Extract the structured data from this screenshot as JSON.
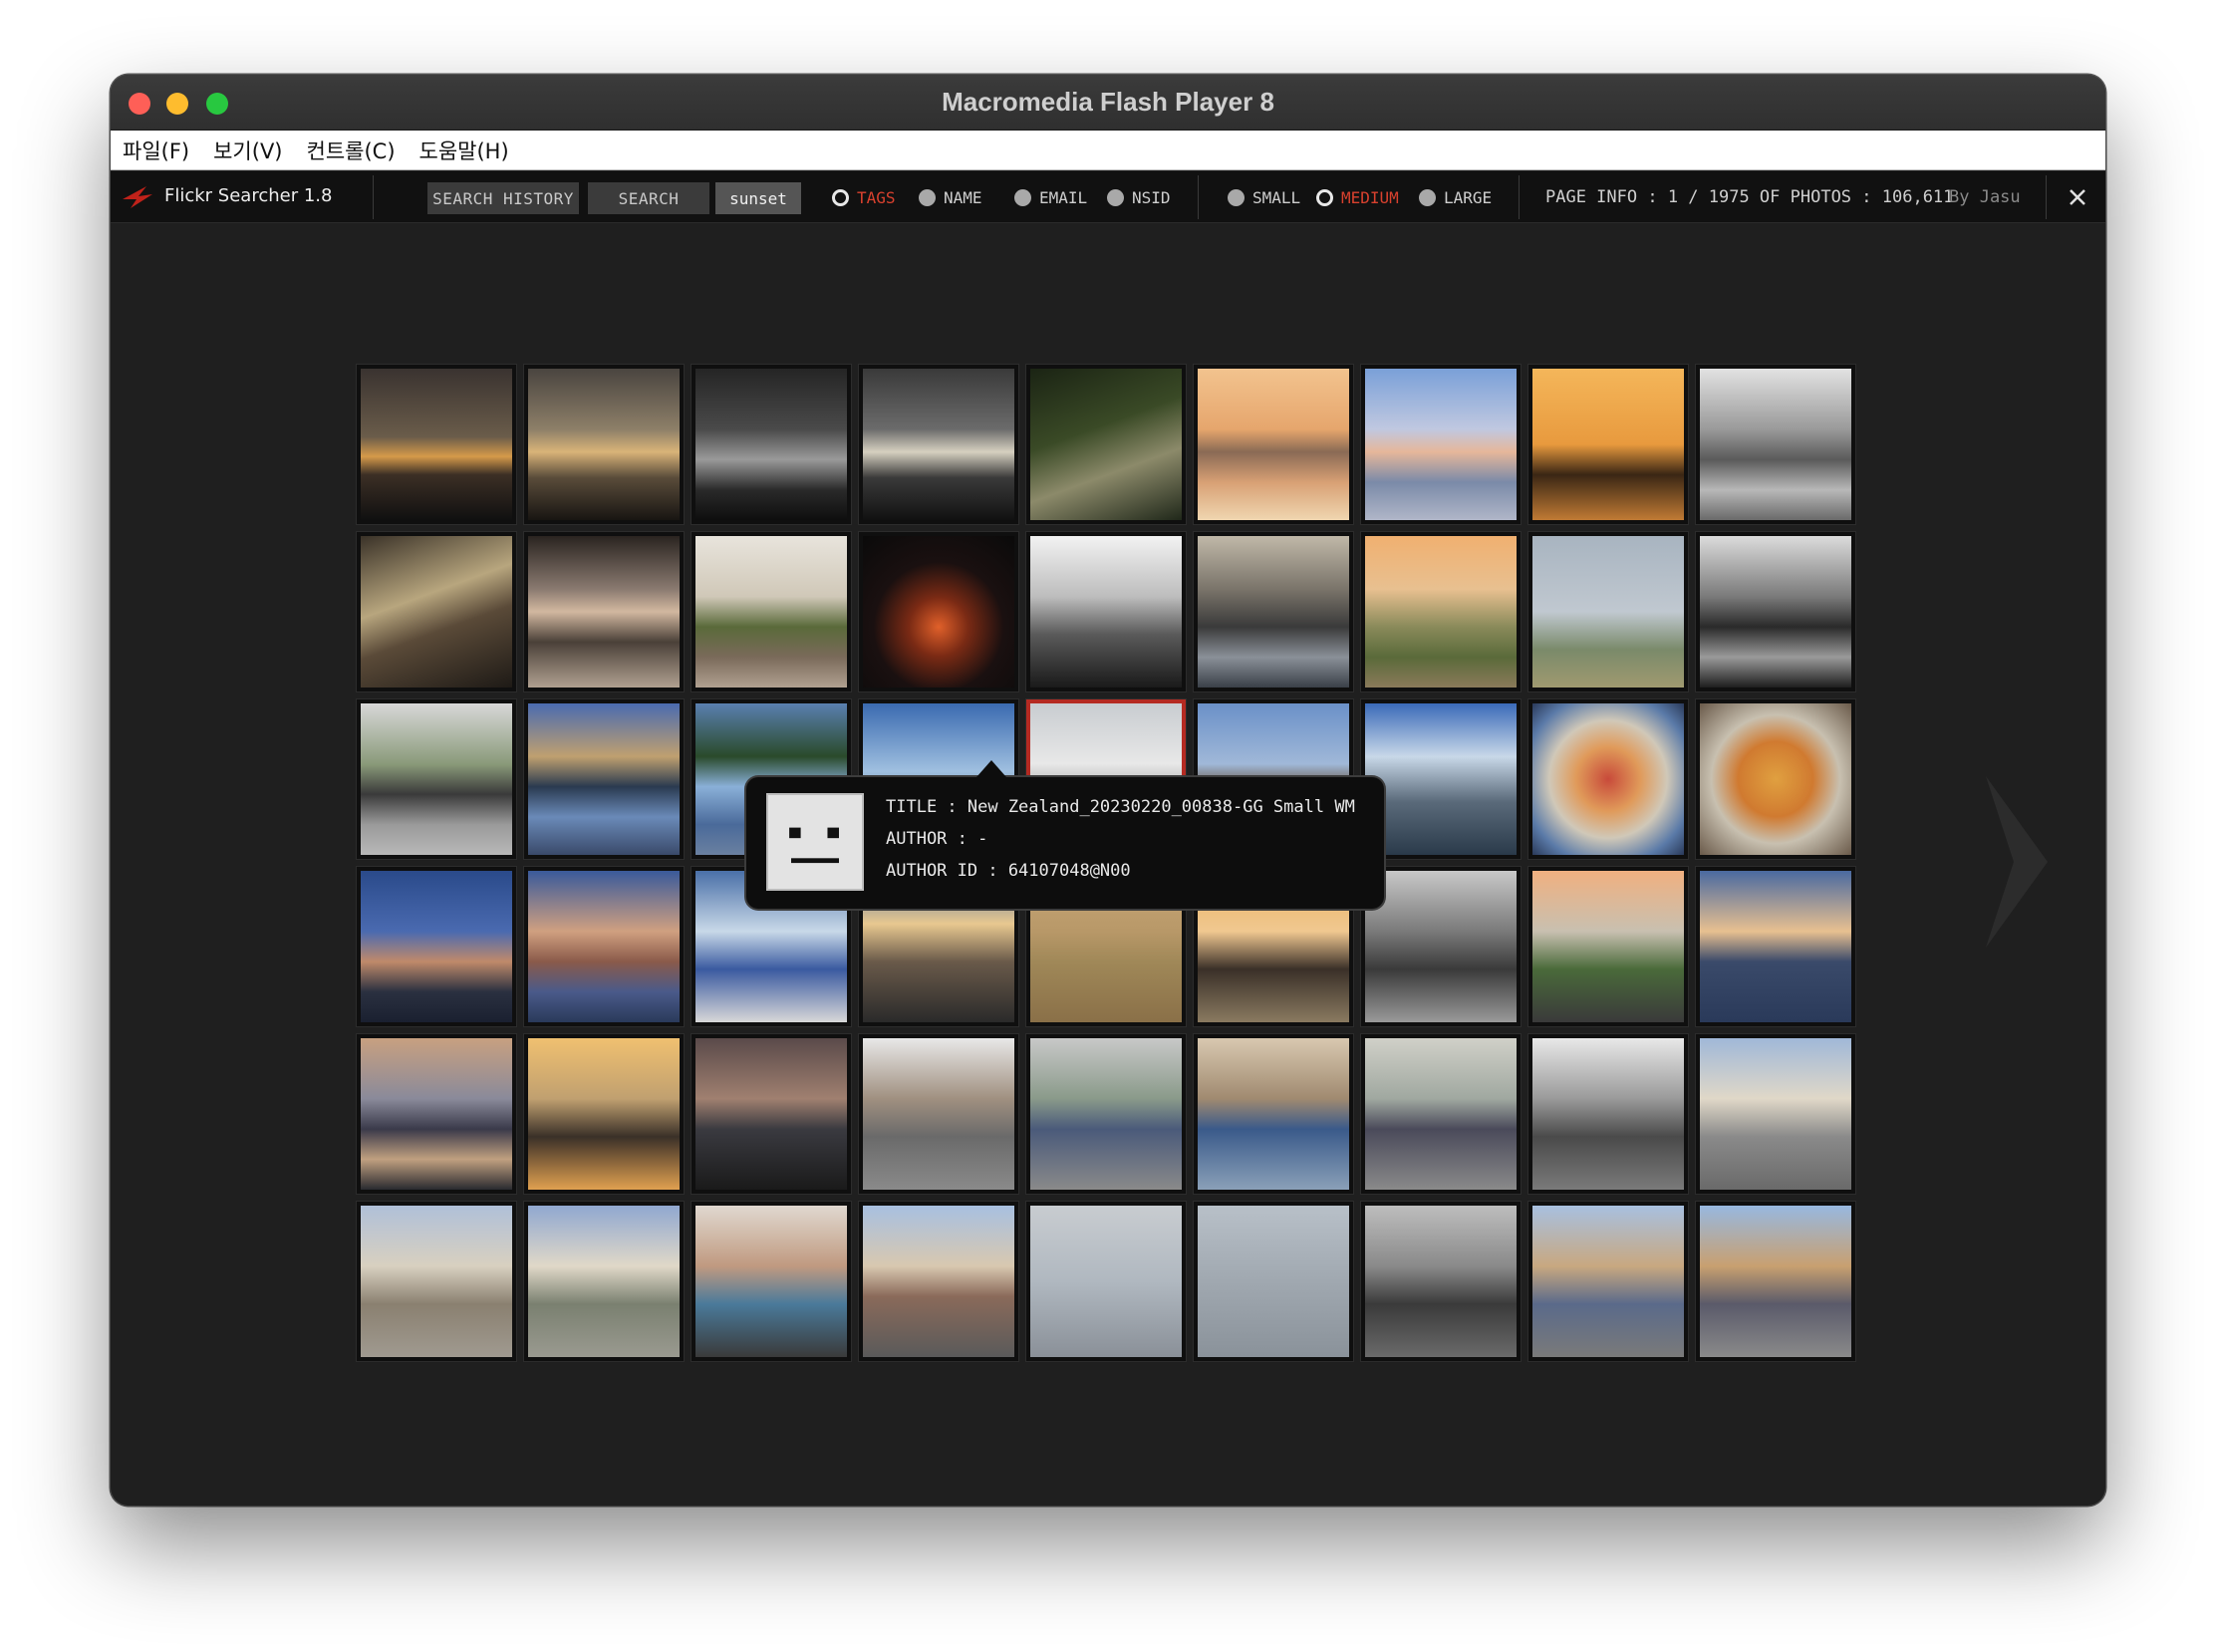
{
  "window": {
    "title": "Macromedia Flash Player 8"
  },
  "menu": [
    "파일(F)",
    "보기(V)",
    "컨트롤(C)",
    "도움말(H)"
  ],
  "toolbar": {
    "app_name": "Flickr Searcher 1.8",
    "search_history_label": "SEARCH HISTORY",
    "search_label": "SEARCH",
    "query": "sunset",
    "search_modes": [
      {
        "label": "TAGS",
        "selected": true
      },
      {
        "label": "NAME",
        "selected": false
      },
      {
        "label": "EMAIL",
        "selected": false
      },
      {
        "label": "NSID",
        "selected": false
      }
    ],
    "sizes": [
      {
        "label": "SMALL",
        "selected": false
      },
      {
        "label": "MEDIUM",
        "selected": true
      },
      {
        "label": "LARGE",
        "selected": false
      }
    ],
    "page_info": "PAGE INFO : 1 / 1975 OF PHOTOS : 106,611",
    "by": "By Jasu"
  },
  "tooltip": {
    "title": "TITLE : New Zealand_20230220_00838-GG Small WM",
    "author": "AUTHOR : -",
    "author_id": "AUTHOR ID : 64107048@N00"
  },
  "colors": {
    "accent": "#d9412e",
    "background": "#1f1f1f",
    "toolbar": "#111111"
  },
  "photos": [
    {
      "bg": "linear-gradient(180deg,#3a3330 0%,#6a5c4a 45%,#d59a4a 58%,#3c2f25 70%,#101010 100%)"
    },
    {
      "bg": "linear-gradient(180deg,#4a4540 0%,#8d7f68 40%,#d9b478 55%,#5a4c3a 72%,#181512 100%)"
    },
    {
      "bg": "linear-gradient(180deg,#252525 0%,#4a4a4a 40%,#9a9a9a 60%,#2a2a2a 80%,#0e0e0e 100%)"
    },
    {
      "bg": "linear-gradient(180deg,#3a3a3a 0%,#6b6b6b 40%,#d6d0c0 55%,#3a3a3a 72%,#111 100%)"
    },
    {
      "bg": "linear-gradient(160deg,#1b2414 0%,#3a4a26 40%,#8c8a6a 65%,#20281a 100%)"
    },
    {
      "bg": "linear-gradient(180deg,#f2c38e 0%,#e6a66d 40%,#8a6a55 55%,#d8a074 75%,#f0d6b0 100%)"
    },
    {
      "bg": "linear-gradient(180deg,#7aa0d8 0%,#c0c8e0 40%,#e6b79a 55%,#7a8aa8 75%,#b0b6c8 100%)"
    },
    {
      "bg": "linear-gradient(180deg,#f4b65a 0%,#e89a3e 50%,#3a2614 70%,#c07a34 100%)"
    },
    {
      "bg": "linear-gradient(180deg,#e2e2e2 0%,#9a9a9a 40%,#5a5a5a 60%,#b8b8b8 80%,#6a6a6a 100%)"
    },
    {
      "bg": "linear-gradient(160deg,#3a3228 0%,#b8a67e 40%,#5a4a38 60%,#1e1a16 100%)"
    },
    {
      "bg": "linear-gradient(180deg,#2a2420 0%,#8a7a70 35%,#d2b8a0 50%,#4a4038 70%,#b0a090 100%)"
    },
    {
      "bg": "linear-gradient(180deg,#e8e4dc 0%,#d0c8b8 40%,#5a6a3a 60%,#7a6a5a 80%,#b0a090 100%)"
    },
    {
      "bg": "radial-gradient(circle at 50% 60%,#e0602a 0%,#7a2a14 25%,#1a1010 55%,#0a0a0a 100%)"
    },
    {
      "bg": "linear-gradient(180deg,#f2f2f2 0%,#bdbdbd 40%,#5a5a5a 65%,#1a1a1a 100%)"
    },
    {
      "bg": "linear-gradient(180deg,#c0b8a8 0%,#7a746a 35%,#3a3a3a 60%,#8a9098 80%,#3a4048 100%)"
    },
    {
      "bg": "linear-gradient(180deg,#f0b070 0%,#e8c090 35%,#8a8a5a 60%,#5a6a3a 80%,#8a7a5a 100%)"
    },
    {
      "bg": "linear-gradient(180deg,#a8b4c0 0%,#c0c8d0 50%,#7a8a6a 75%,#a09a70 100%)"
    },
    {
      "bg": "linear-gradient(180deg,#dcdcdc 0%,#7a7a7a 40%,#2a2a2a 60%,#9a9a9a 80%,#1e1e1e 100%)"
    },
    {
      "bg": "linear-gradient(180deg,#d8d8d8 0%,#8a9a7a 40%,#3a3a3a 60%,#9a9a9a 80%,#b8b8b8 100%)"
    },
    {
      "bg": "linear-gradient(180deg,#4a6ab0 0%,#c0a070 35%,#2a3a50 55%,#6a8ab8 75%,#3a4a6a 100%)"
    },
    {
      "bg": "linear-gradient(180deg,#5a80b0 0%,#2a4a2a 35%,#8ab0d8 55%,#4a6a9a 80%,#6a80a0 100%)"
    },
    {
      "bg": "linear-gradient(180deg,#3a6ab0 0%,#a0c0e0 45%,#5a6a7a 70%,#8aa0b8 100%)"
    },
    {
      "bg": "linear-gradient(180deg,#c8ccd0 0%,#e8e8e8 40%,#8a8a8a 70%,#5a5a5a 100%)"
    },
    {
      "bg": "linear-gradient(180deg,#6a90c8 0%,#a0b8d8 40%,#6a5a4a 55%,#3a5a8a 75%,#5a7aa8 100%)"
    },
    {
      "bg": "linear-gradient(180deg,#3a6ab8 0%,#c8d8e8 35%,#5a6a7a 65%,#2a3a4a 100%)"
    },
    {
      "bg": "radial-gradient(circle at 50% 50%,#c84a3a 0%,#e09a5a 30%,#d0c8b8 55%,#5a7aa8 80%,#2a3a5a 100%)"
    },
    {
      "bg": "radial-gradient(circle at 50% 50%,#e0a040 0%,#d07a30 35%,#c8c0b0 60%,#6a5a4a 100%)"
    },
    {
      "bg": "linear-gradient(180deg,#2a4a8a 0%,#4a6ab0 40%,#c08a6a 60%,#2a3040 80%,#1a2030 100%)"
    },
    {
      "bg": "linear-gradient(180deg,#3a5a9a 0%,#d0a080 40%,#8a5a4a 60%,#4a5a8a 80%,#2a3a5a 100%)"
    },
    {
      "bg": "linear-gradient(180deg,#4a70a8 0%,#c8d8e8 40%,#3a5aa0 65%,#d8d8d8 100%)"
    },
    {
      "bg": "linear-gradient(180deg,#4a6aa0 0%,#e8c890 35%,#6a5a4a 60%,#2a2a2a 100%)"
    },
    {
      "bg": "linear-gradient(180deg,#c8a878 0%,#b89868 40%,#a08858 60%,#8a7048 100%)"
    },
    {
      "bg": "linear-gradient(180deg,#e8b060 0%,#f0c890 40%,#3a3028 65%,#8a7a60 100%)"
    },
    {
      "bg": "linear-gradient(180deg,#c8c8c8 0%,#7a7a7a 40%,#3a3a3a 65%,#9a9a9a 100%)"
    },
    {
      "bg": "linear-gradient(180deg,#f0b080 0%,#c8c0b0 40%,#4a6a3a 65%,#3a3a3a 100%)"
    },
    {
      "bg": "linear-gradient(180deg,#4a6aa0 0%,#e8c090 40%,#3a4a6a 60%,#2a3a5a 100%)"
    },
    {
      "bg": "linear-gradient(180deg,#c8a080 0%,#8a8a9a 40%,#3a3a4a 60%,#c0a080 80%,#2a2a30 100%)"
    },
    {
      "bg": "linear-gradient(180deg,#f0c070 0%,#c0a070 40%,#3a3028 65%,#e0a050 100%)"
    },
    {
      "bg": "linear-gradient(180deg,#5a4a4a 0%,#a08070 40%,#3a3a40 60%,#1a1a1a 100%)"
    },
    {
      "bg": "linear-gradient(180deg,#e8e8e8 0%,#a09080 40%,#6a6a6a 65%,#8a8a8a 100%)"
    },
    {
      "bg": "linear-gradient(180deg,#c8c8c8 0%,#8a9a8a 40%,#4a5a7a 60%,#8a8a8a 100%)"
    },
    {
      "bg": "linear-gradient(180deg,#d8c8b0 0%,#a08a70 40%,#3a5a8a 60%,#8aa0b8 100%)"
    },
    {
      "bg": "linear-gradient(180deg,#d0d0c8 0%,#a0a8a0 40%,#4a4a5a 60%,#8a8a8a 100%)"
    },
    {
      "bg": "linear-gradient(180deg,#e8e8e8 0%,#9a9a9a 40%,#4a4a4a 65%,#7a7a7a 100%)"
    },
    {
      "bg": "linear-gradient(180deg,#a0b8d8 0%,#e0d8c8 40%,#8a8a8a 65%,#6a6a6a 100%)"
    },
    {
      "bg": "linear-gradient(180deg,#b0c0d8 0%,#d8d0c0 40%,#8a8070 65%,#a09a90 100%)"
    },
    {
      "bg": "linear-gradient(180deg,#90a8d0 0%,#e0d8c8 40%,#7a8070 65%,#9a9a90 100%)"
    },
    {
      "bg": "linear-gradient(180deg,#e0d8d0 0%,#c09a80 40%,#4a7a9a 65%,#3a3a3a 100%)"
    },
    {
      "bg": "linear-gradient(180deg,#a8c0e0 0%,#d8c8b0 40%,#8a6a5a 60%,#5a5a5a 100%)"
    },
    {
      "bg": "linear-gradient(180deg,#c8ccd0 0%,#b0b8c0 50%,#8a9098 100%)"
    },
    {
      "bg": "linear-gradient(180deg,#b8c0c8 0%,#a0a8b0 50%,#8a929a 100%)"
    },
    {
      "bg": "linear-gradient(180deg,#bdbdbd 0%,#8a8a8a 40%,#3a3a3a 65%,#6a6a6a 100%)"
    },
    {
      "bg": "linear-gradient(180deg,#a8c0e0 0%,#c8a880 40%,#5a6a8a 65%,#7a7a7a 100%)"
    },
    {
      "bg": "linear-gradient(180deg,#98b8e0 0%,#c8a070 40%,#5a5a6a 65%,#8a8a8a 100%)"
    }
  ]
}
